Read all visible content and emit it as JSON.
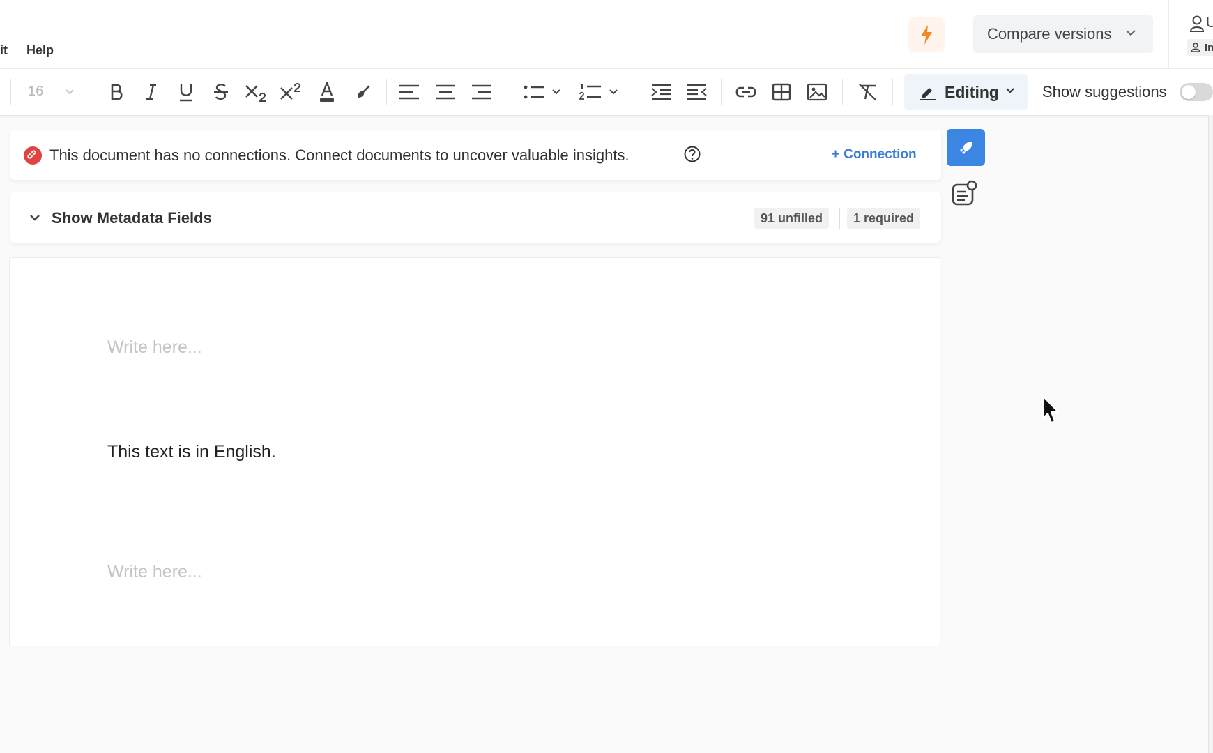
{
  "menu": {
    "items": [
      {
        "label": "it"
      },
      {
        "label": "Help"
      }
    ]
  },
  "header": {
    "bolt_icon": "lightning-icon",
    "compare_versions": {
      "label": "Compare versions"
    },
    "user": {
      "letter": "U",
      "chip_label": "In"
    }
  },
  "toolbar": {
    "font_size": "16",
    "icons": [
      "bold-icon",
      "italic-icon",
      "underline-icon",
      "strikethrough-icon",
      "subscript-icon",
      "superscript-icon",
      "text-color-icon",
      "highlight-icon",
      "align-left-icon",
      "align-center-icon",
      "align-right-icon",
      "bullet-list-icon",
      "numbered-list-icon",
      "indent-icon",
      "outdent-icon",
      "link-icon",
      "table-icon",
      "image-icon",
      "clear-format-icon"
    ],
    "mode": {
      "label": "Editing"
    },
    "show_suggestions": {
      "label": "Show suggestions",
      "enabled": false
    }
  },
  "banner": {
    "message": "This document has no connections. Connect documents to uncover valuable insights.",
    "connection_button": "Connection",
    "connection_prefix": "+"
  },
  "metadata": {
    "label": "Show Metadata Fields",
    "unfilled": "91 unfilled",
    "required": "1 required"
  },
  "editor": {
    "blocks": [
      {
        "type": "placeholder",
        "text": "Write here..."
      },
      {
        "type": "paragraph",
        "text": "This text is in English."
      },
      {
        "type": "placeholder",
        "text": "Write here..."
      }
    ]
  },
  "colors": {
    "accent_blue": "#3a86e2",
    "link_blue": "#3a7bd5",
    "alert_red": "#e0443e",
    "bolt_orange": "#f0872a"
  }
}
